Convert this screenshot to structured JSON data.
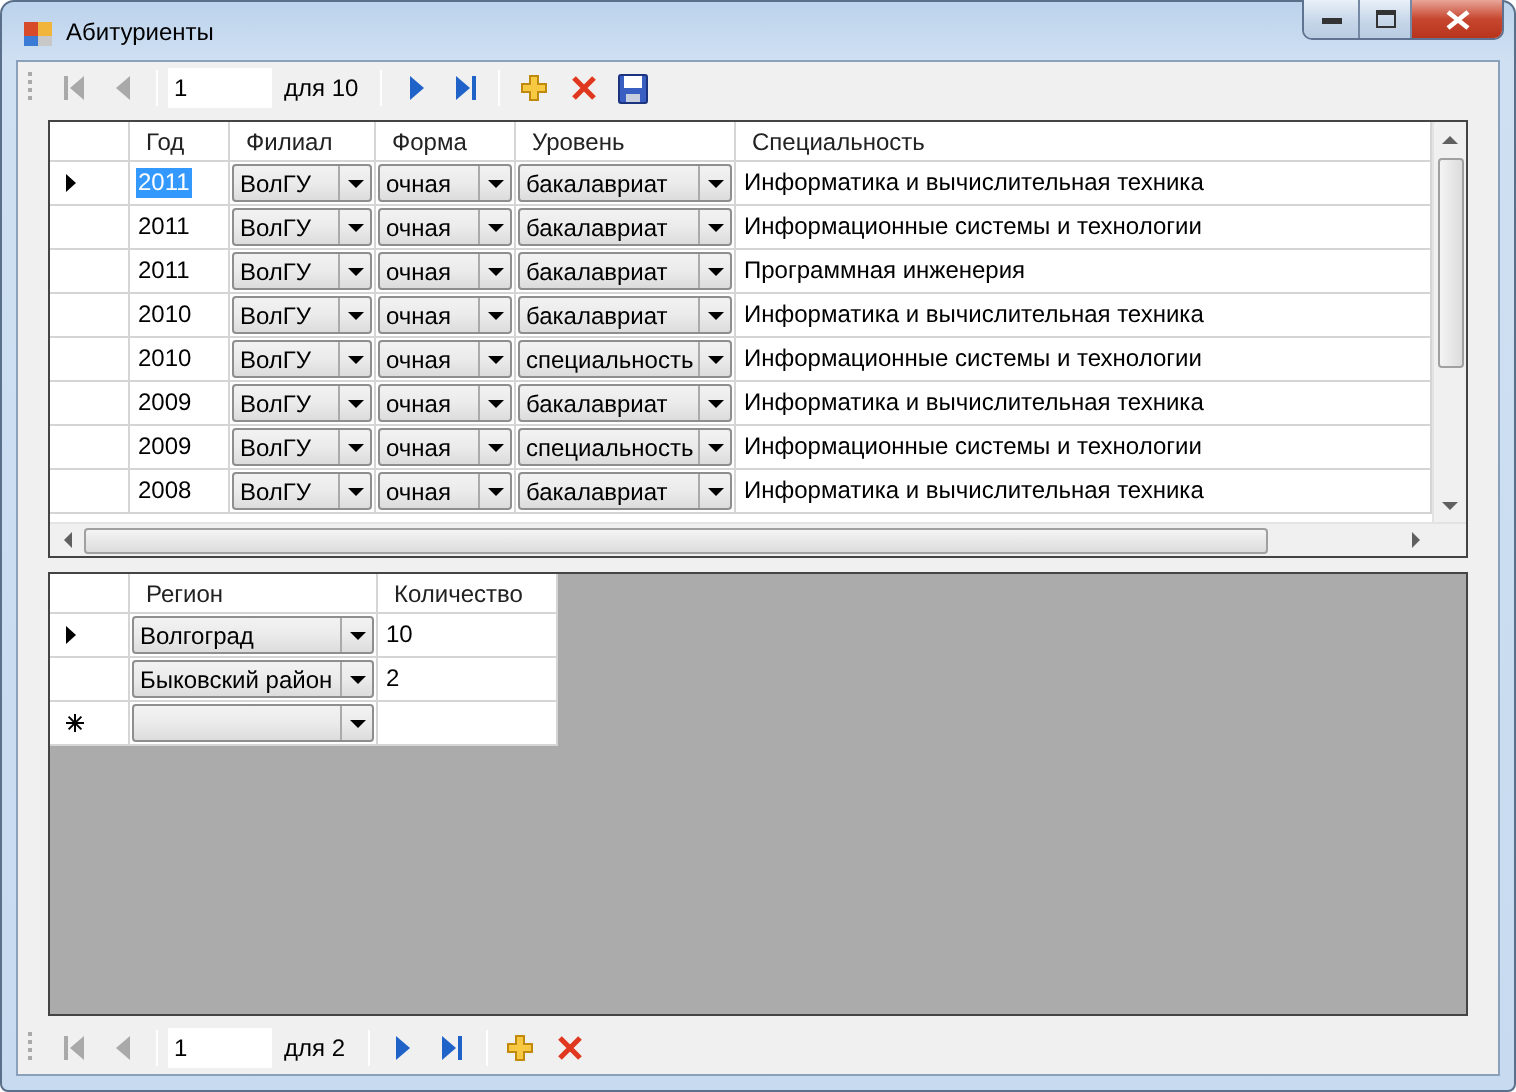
{
  "window": {
    "title": "Абитуриенты"
  },
  "top_navigator": {
    "items": [
      {
        "kind": "first",
        "disabled": true
      },
      {
        "kind": "prev",
        "disabled": true
      },
      {
        "kind": "separator"
      },
      {
        "kind": "position",
        "value": "1"
      },
      {
        "kind": "count",
        "text": "для 10"
      },
      {
        "kind": "separator"
      },
      {
        "kind": "next",
        "disabled": false
      },
      {
        "kind": "last",
        "disabled": false
      },
      {
        "kind": "separator"
      },
      {
        "kind": "add",
        "disabled": false
      },
      {
        "kind": "delete",
        "disabled": false
      },
      {
        "kind": "save",
        "disabled": false
      }
    ]
  },
  "applicants_table": {
    "columns": [
      "Год",
      "Филиал",
      "Форма",
      "Уровень",
      "Специальность"
    ],
    "rows": [
      {
        "selected": true,
        "year": "2011",
        "branch": "ВолГУ",
        "form": "очная",
        "level": "бакалавриат",
        "specialty": "Информатика и вычислительная техника"
      },
      {
        "selected": false,
        "year": "2011",
        "branch": "ВолГУ",
        "form": "очная",
        "level": "бакалавриат",
        "specialty": "Информационные системы и технологии"
      },
      {
        "selected": false,
        "year": "2011",
        "branch": "ВолГУ",
        "form": "очная",
        "level": "бакалавриат",
        "specialty": "Программная инженерия"
      },
      {
        "selected": false,
        "year": "2010",
        "branch": "ВолГУ",
        "form": "очная",
        "level": "бакалавриат",
        "specialty": "Информатика и вычислительная техника"
      },
      {
        "selected": false,
        "year": "2010",
        "branch": "ВолГУ",
        "form": "очная",
        "level": "специальность",
        "specialty": "Информационные системы и технологии"
      },
      {
        "selected": false,
        "year": "2009",
        "branch": "ВолГУ",
        "form": "очная",
        "level": "бакалавриат",
        "specialty": "Информатика и вычислительная техника"
      },
      {
        "selected": false,
        "year": "2009",
        "branch": "ВолГУ",
        "form": "очная",
        "level": "специальность",
        "specialty": "Информационные системы и технологии"
      },
      {
        "selected": false,
        "year": "2008",
        "branch": "ВолГУ",
        "form": "очная",
        "level": "бакалавриат",
        "specialty": "Информатика и вычислительная техника"
      }
    ]
  },
  "regions_table": {
    "columns": [
      "Регион",
      "Количество"
    ],
    "rows": [
      {
        "kind": "data",
        "selected": true,
        "region": "Волгоград",
        "count": "10"
      },
      {
        "kind": "data",
        "selected": false,
        "region": "Быковский район",
        "count": "2"
      },
      {
        "kind": "new"
      }
    ]
  },
  "bottom_navigator": {
    "items": [
      {
        "kind": "first",
        "disabled": true
      },
      {
        "kind": "prev",
        "disabled": true
      },
      {
        "kind": "separator"
      },
      {
        "kind": "position",
        "value": "1"
      },
      {
        "kind": "count",
        "text": "для 2"
      },
      {
        "kind": "separator"
      },
      {
        "kind": "next",
        "disabled": false
      },
      {
        "kind": "last",
        "disabled": false
      },
      {
        "kind": "separator"
      },
      {
        "kind": "add",
        "disabled": false
      },
      {
        "kind": "delete",
        "disabled": false
      }
    ]
  }
}
